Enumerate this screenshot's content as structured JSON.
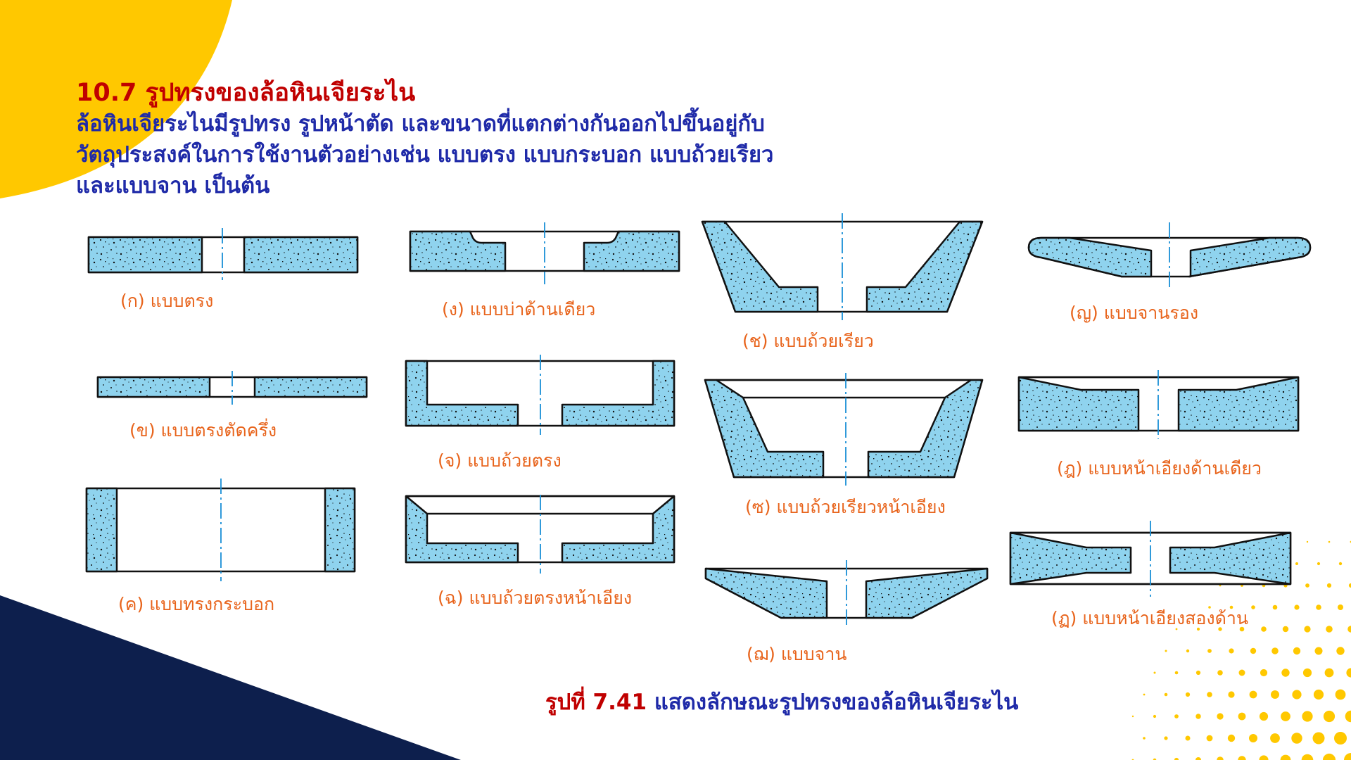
{
  "header": {
    "section_number": "10.7",
    "section_title": "รูปทรงของล้อหินเจียระไน",
    "description_lines": [
      "ล้อหินเจียระไนมีรูปทรง รูปหน้าตัด และขนาดที่แตกต่างกันออกไปขึ้นอยู่กับ",
      "วัตถุประสงค์ในการใช้งานตัวอย่างเช่น แบบตรง แบบกระบอก แบบถ้วยเรียว",
      "และแบบจาน เป็นต้น"
    ]
  },
  "shapes": {
    "straight": "(ก) แบบตรง",
    "straight_half": "(ข) แบบตรงตัดครึ่ง",
    "cylinder": "(ค) แบบทรงกระบอก",
    "recess_one_side": "(ง) แบบบ่าด้านเดียว",
    "straight_cup": "(จ) แบบถ้วยตรง",
    "straight_cup_bevel": "(ฉ) แบบถ้วยตรงหน้าเอียง",
    "flaring_cup": "(ช) แบบถ้วยเรียว",
    "flaring_cup_bevel": "(ซ) แบบถ้วยเรียวหน้าเอียง",
    "dish": "(ฌ) แบบจาน",
    "saucer": "(ญ) แบบจานรอง",
    "tapered_one_side": "(ฎ) แบบหน้าเอียงด้านเดียว",
    "tapered_two_sides": "(ฏ) แบบหน้าเอียงสองด้าน"
  },
  "caption": {
    "figure_number": "รูปที่ 7.41",
    "figure_text": "แสดงลักษณะรูปทรงของล้อหินเจียระไน"
  },
  "colors": {
    "abrasive_fill": "#8fd3ee",
    "centerline": "#1a8fd6",
    "label": "#e8641c",
    "title_red": "#c00000",
    "text_blue": "#1f2aa8",
    "accent_yellow": "#ffc800",
    "accent_navy": "#0d1f4d"
  }
}
